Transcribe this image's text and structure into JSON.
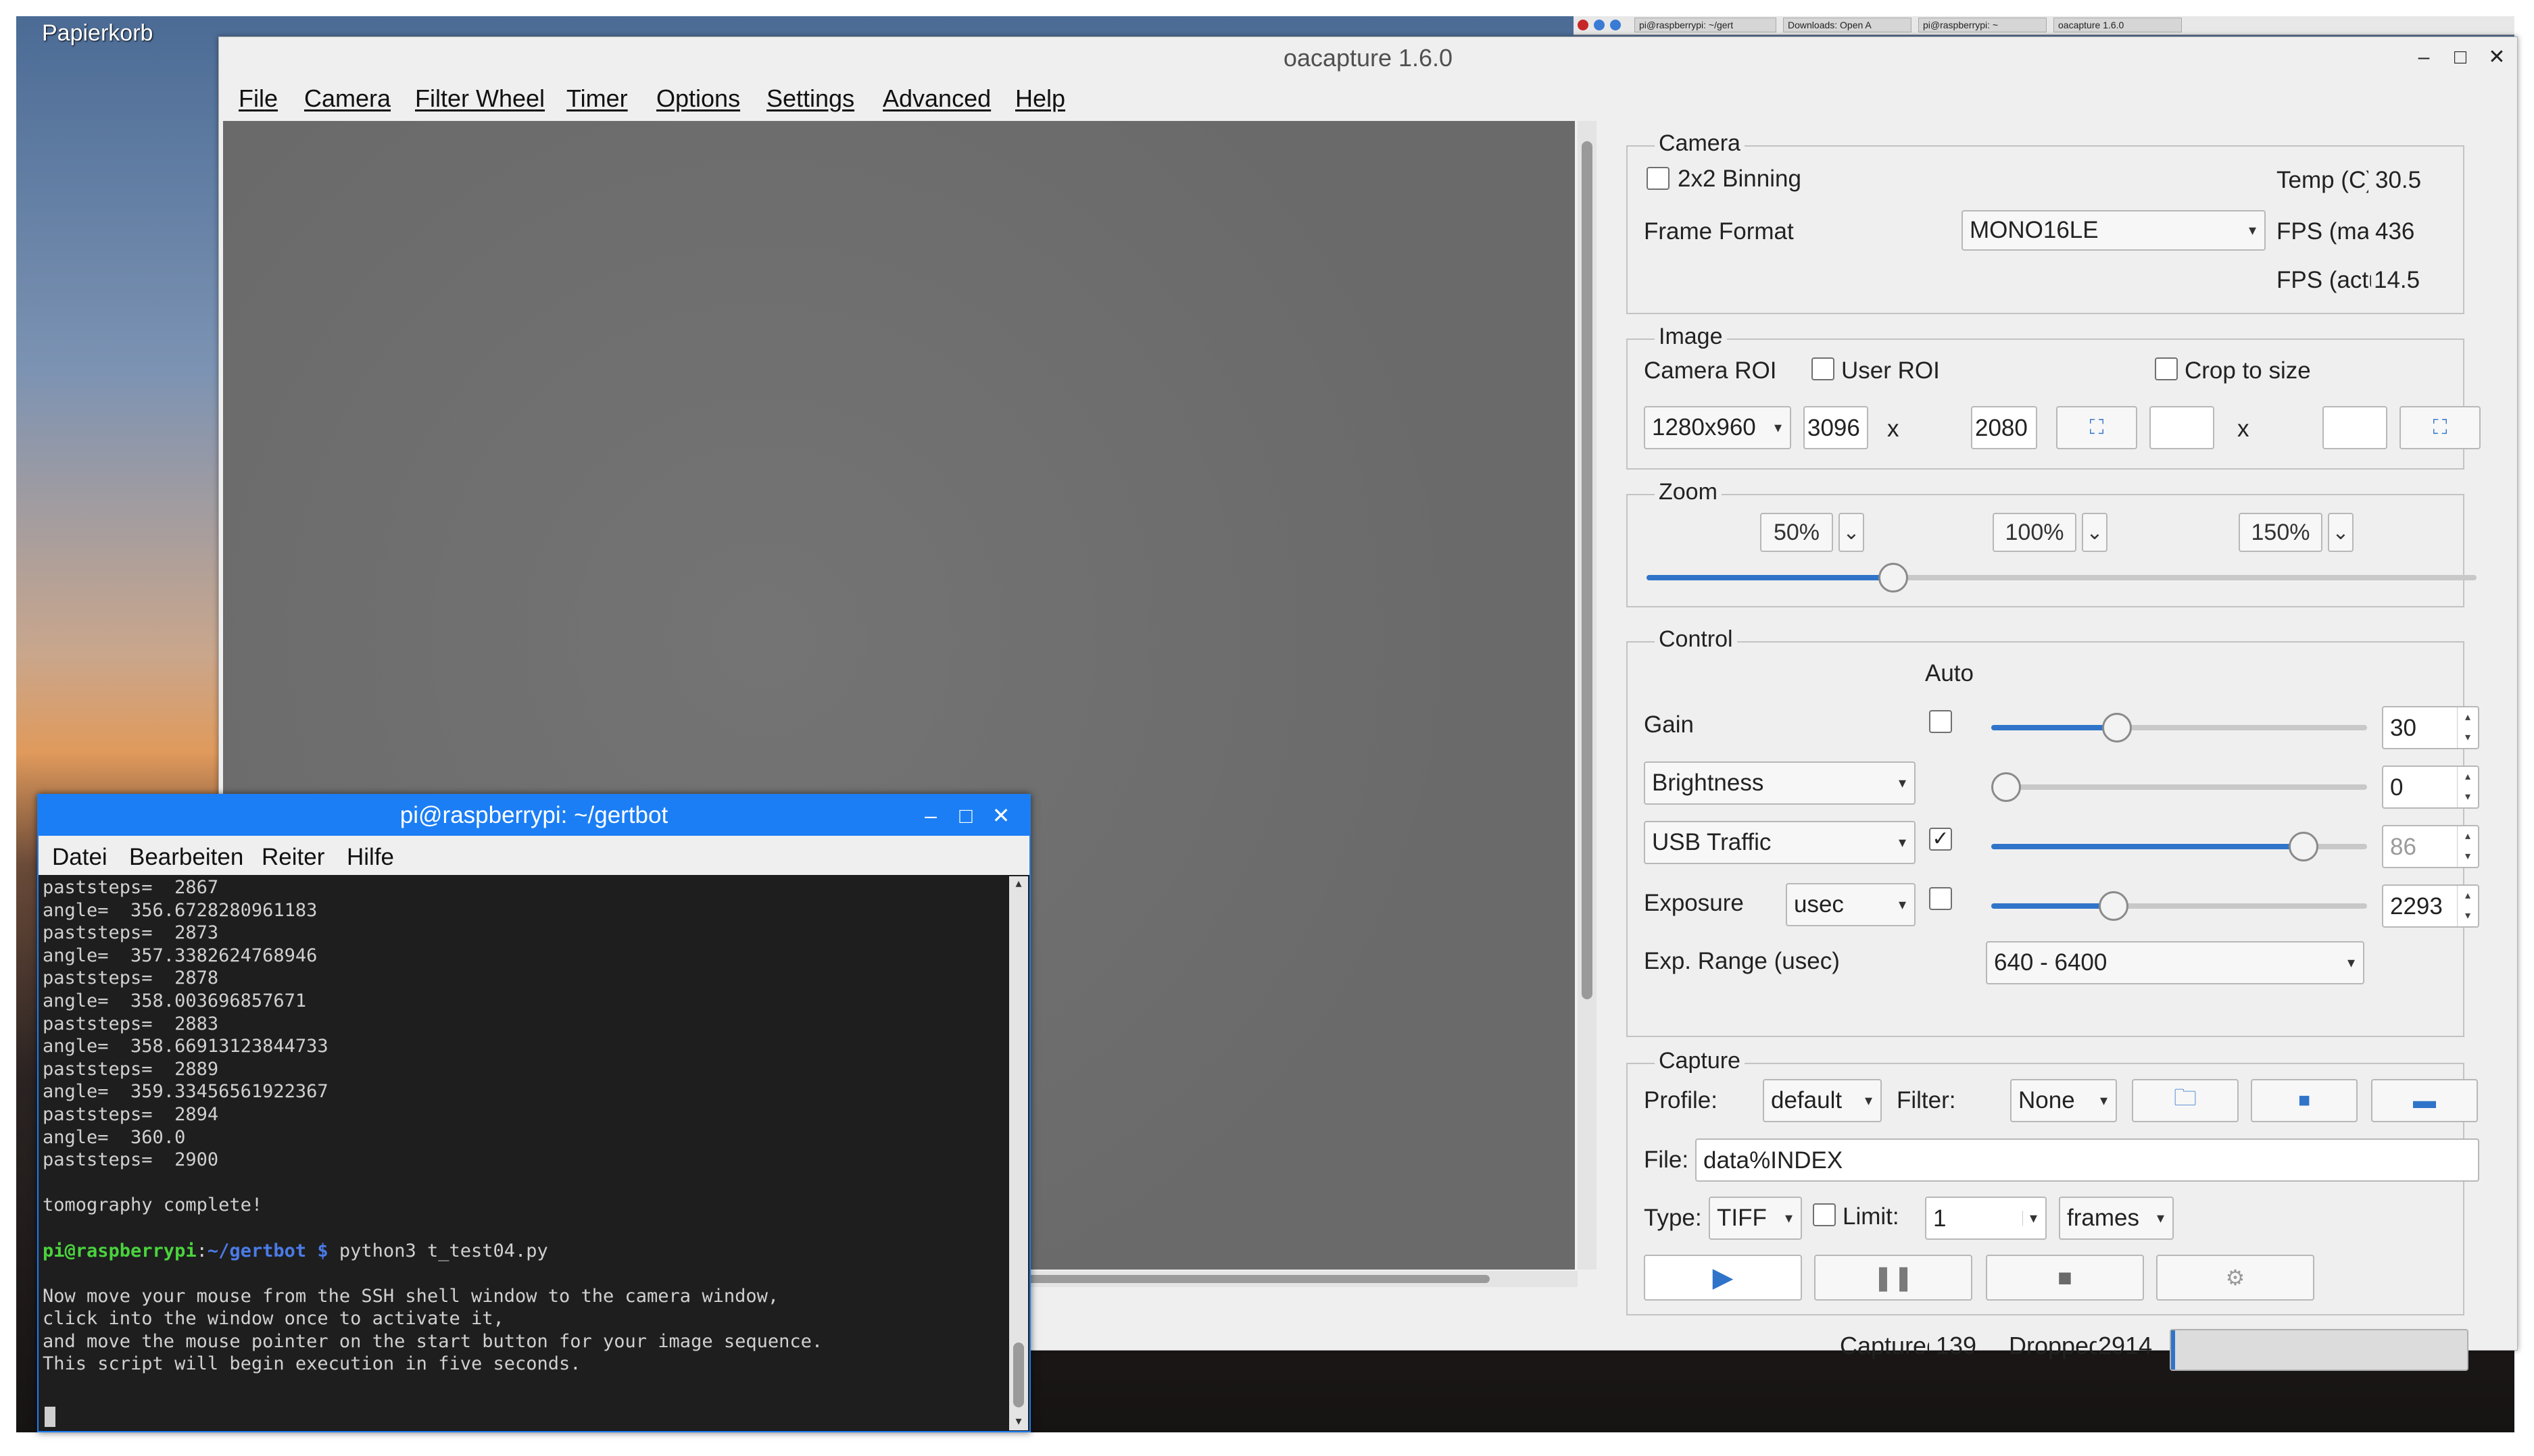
{
  "desktop": {
    "trash_label": "Papierkorb",
    "taskbar_items": [
      "pi@raspberrypi: ~/gert",
      "Downloads: Open A",
      "pi@raspberrypi: ~",
      "oacapture 1.6.0"
    ]
  },
  "window": {
    "title": "oacapture 1.6.0",
    "controls": {
      "minimize": "–",
      "maximize": "□",
      "close": "✕"
    }
  },
  "menu": [
    "File",
    "Camera",
    "Filter Wheel",
    "Timer",
    "Options",
    "Settings",
    "Advanced",
    "Help"
  ],
  "camera": {
    "group_title": "Camera",
    "binning_label": "2x2 Binning",
    "binning_checked": false,
    "frame_format_label": "Frame Format",
    "frame_format_value": "MONO16LE",
    "temp_label": "Temp (C)",
    "temp_value": "30.5",
    "fps_max_label": "FPS (max)",
    "fps_max_value": "436",
    "fps_actual_label": "FPS (actual)",
    "fps_actual_value": "14.5"
  },
  "image": {
    "group_title": "Image",
    "camera_roi_label": "Camera ROI",
    "user_roi_label": "User ROI",
    "user_roi_checked": false,
    "crop_label": "Crop to size",
    "crop_checked": false,
    "roi_select": "1280x960",
    "width": "3096",
    "times": "x",
    "height": "2080",
    "crop_width": "",
    "crop_height": ""
  },
  "zoom": {
    "group_title": "Zoom",
    "presets": [
      "50%",
      "100%",
      "150%"
    ],
    "level_fraction": 0.29
  },
  "control": {
    "group_title": "Control",
    "auto_label": "Auto",
    "gain": {
      "label": "Gain",
      "auto": false,
      "value": "30",
      "fraction": 0.32
    },
    "brightness": {
      "label": "Brightness",
      "value": "0",
      "fraction": 0.0
    },
    "usb_traffic": {
      "label": "USB Traffic",
      "auto": true,
      "value": "86",
      "fraction": 0.86
    },
    "exposure": {
      "label": "Exposure",
      "unit": "usec",
      "auto": false,
      "value": "2293",
      "fraction": 0.31
    },
    "exp_range_label": "Exp. Range (usec)",
    "exp_range_value": "640 - 6400"
  },
  "capture": {
    "group_title": "Capture",
    "profile_label": "Profile:",
    "profile_value": "default",
    "filter_label": "Filter:",
    "filter_value": "None",
    "file_label": "File:",
    "file_value": "data%INDEX",
    "type_label": "Type:",
    "type_value": "TIFF",
    "limit_label": "Limit:",
    "limit_checked": false,
    "limit_value": "1",
    "limit_unit": "frames"
  },
  "status": {
    "captured_label": "Captured",
    "captured_value": "139",
    "dropped_label": "Dropped",
    "dropped_value": "2914"
  },
  "terminal": {
    "title": "pi@raspberrypi: ~/gertbot",
    "menu": [
      "Datei",
      "Bearbeiten",
      "Reiter",
      "Hilfe"
    ],
    "lines": [
      "paststeps=  2867",
      "angle=  356.6728280961183",
      "paststeps=  2873",
      "angle=  357.3382624768946",
      "paststeps=  2878",
      "angle=  358.003696857671",
      "paststeps=  2883",
      "angle=  358.66913123844733",
      "paststeps=  2889",
      "angle=  359.33456561922367",
      "paststeps=  2894",
      "angle=  360.0",
      "paststeps=  2900",
      "",
      "tomography complete!",
      ""
    ],
    "prompt_user": "pi@raspberrypi",
    "prompt_sep": ":",
    "prompt_path": "~/gertbot $",
    "prompt_cmd": " python3 t_test04.py",
    "message": [
      "",
      "Now move your mouse from the SSH shell window to the camera window,",
      "click into the window once to activate it,",
      "and move the mouse pointer on the start button for your image sequence.",
      "This script will begin execution in five seconds."
    ]
  }
}
